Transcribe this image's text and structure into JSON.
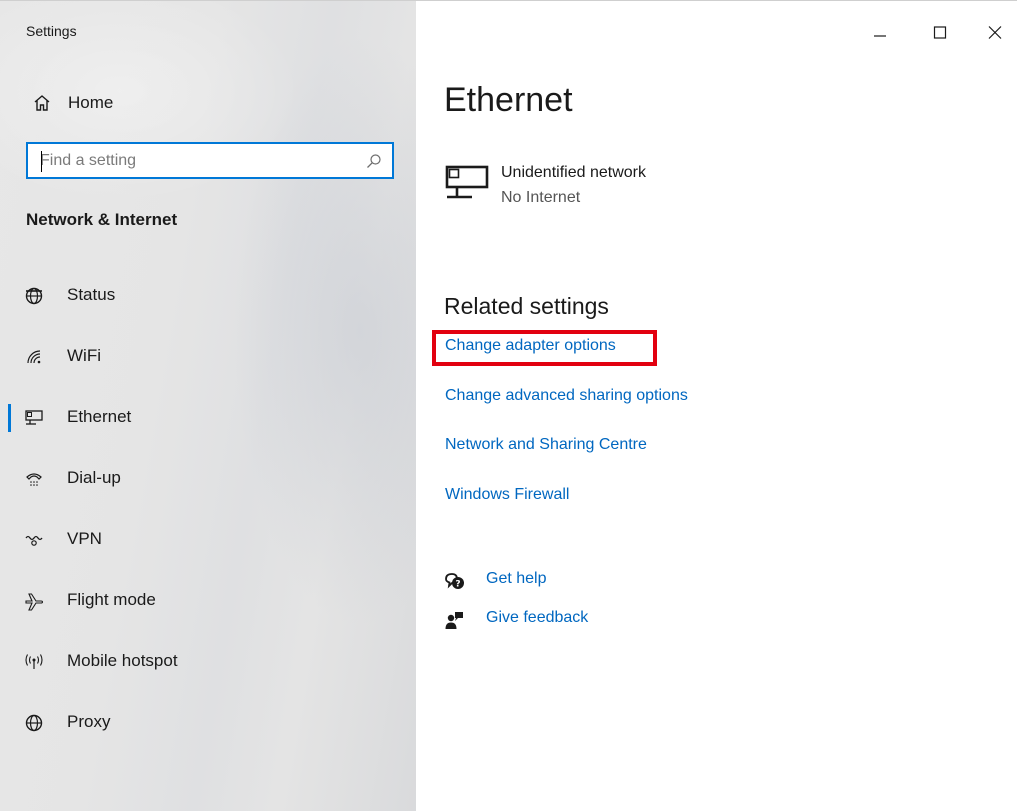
{
  "window": {
    "title": "Settings",
    "controls": [
      "minimize-icon",
      "maximize-icon",
      "close-icon"
    ]
  },
  "sidebar": {
    "home_label": "Home",
    "search_placeholder": "Find a setting",
    "section_title": "Network & Internet",
    "items": [
      {
        "label": "Status",
        "icon": "globe-status-icon",
        "selected": false
      },
      {
        "label": "WiFi",
        "icon": "wifi-icon",
        "selected": false
      },
      {
        "label": "Ethernet",
        "icon": "ethernet-icon",
        "selected": true
      },
      {
        "label": "Dial-up",
        "icon": "dial-up-icon",
        "selected": false
      },
      {
        "label": "VPN",
        "icon": "vpn-icon",
        "selected": false
      },
      {
        "label": "Flight mode",
        "icon": "airplane-icon",
        "selected": false
      },
      {
        "label": "Mobile hotspot",
        "icon": "hotspot-icon",
        "selected": false
      },
      {
        "label": "Proxy",
        "icon": "proxy-globe-icon",
        "selected": false
      }
    ]
  },
  "main": {
    "title": "Ethernet",
    "network": {
      "name": "Unidentified network",
      "status": "No Internet"
    },
    "related_title": "Related settings",
    "links": [
      "Change adapter options",
      "Change advanced sharing options",
      "Network and Sharing Centre",
      "Windows Firewall"
    ],
    "highlighted_link_index": 0,
    "help": {
      "get_help": "Get help",
      "give_feedback": "Give feedback"
    }
  },
  "colors": {
    "accent": "#0078d7",
    "link": "#0067c0",
    "highlight": "#e2000f"
  }
}
